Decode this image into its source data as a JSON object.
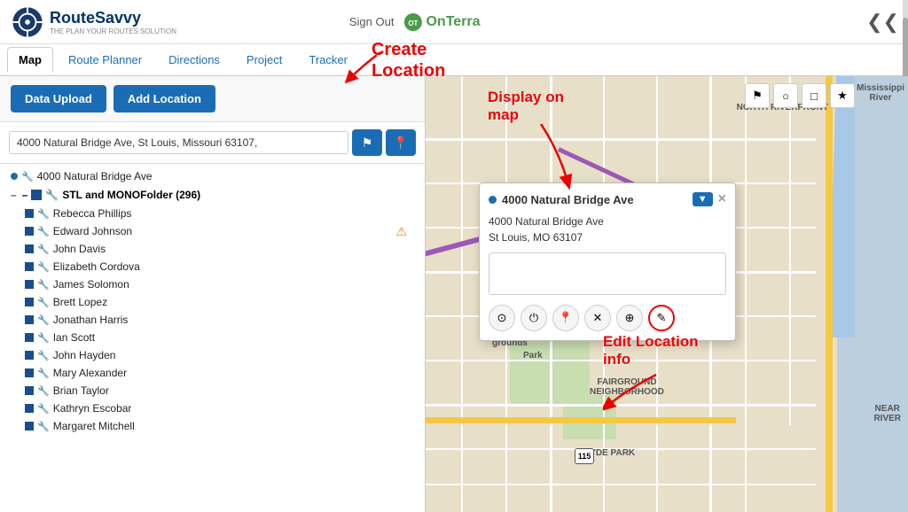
{
  "header": {
    "logo_text": "RouteSavvy",
    "logo_sub": "THE PLAN YOUR ROUTES SOLUTION",
    "sign_out": "Sign Out",
    "onterra": "OnTerra",
    "collapse_icon": "❮❮"
  },
  "nav": {
    "tabs": [
      {
        "label": "Map",
        "active": true
      },
      {
        "label": "Route Planner"
      },
      {
        "label": "Directions"
      },
      {
        "label": "Project"
      },
      {
        "label": "Tracker"
      }
    ]
  },
  "toolbar": {
    "data_upload": "Data Upload",
    "add_location": "Add Location"
  },
  "search": {
    "value": "4000 Natural Bridge Ave, St Louis, Missouri 63107,",
    "flag_icon": "⚑",
    "pin_icon": "📍"
  },
  "annotations": {
    "create_location": "Create\nLocation",
    "display_on_map": "Display on\nmap",
    "edit_location": "Edit Location\ninfo"
  },
  "location_list": {
    "top_item": {
      "label": "4000 Natural Bridge Ave"
    },
    "folder": {
      "label": "STL and MONOFolder (296)"
    },
    "items": [
      {
        "label": "Rebecca Phillips"
      },
      {
        "label": "Edward Johnson",
        "warning": true
      },
      {
        "label": "John Davis"
      },
      {
        "label": "Elizabeth Cordova"
      },
      {
        "label": "James Solomon"
      },
      {
        "label": "Brett Lopez"
      },
      {
        "label": "Jonathan Harris"
      },
      {
        "label": "Ian Scott"
      },
      {
        "label": "John Hayden"
      },
      {
        "label": "Mary Alexander"
      },
      {
        "label": "Brian Taylor"
      },
      {
        "label": "Kathryn Escobar"
      },
      {
        "label": "Margaret Mitchell"
      }
    ]
  },
  "popup": {
    "title": "4000 Natural Bridge Ave",
    "address_line1": "4000 Natural Bridge Ave",
    "address_line2": "St Louis, MO 63107",
    "close": "×",
    "dropdown_arrow": "▼",
    "actions": [
      {
        "icon": "⊙",
        "label": "target"
      },
      {
        "icon": "⏻",
        "label": "power"
      },
      {
        "icon": "📍",
        "label": "pin"
      },
      {
        "icon": "✕",
        "label": "close"
      },
      {
        "icon": "⊕",
        "label": "add"
      },
      {
        "icon": "✎",
        "label": "edit"
      }
    ]
  },
  "map": {
    "labels": [
      {
        "text": "Mississippi\nRiver",
        "top": "10",
        "right": "8"
      },
      {
        "text": "NORTH RIVERFRONT",
        "top": "38",
        "right": "30"
      },
      {
        "text": "FAIRGROUND\nNEIGHBORHOOD",
        "top": "345",
        "left": "200"
      },
      {
        "text": "HYDE PARK",
        "top": "420",
        "left": "180"
      },
      {
        "text": "NEAR\nRIVER",
        "top": "370",
        "right": "5"
      },
      {
        "text": "Park",
        "top": "310",
        "left": "120"
      },
      {
        "text": "Fair-\ngrounds",
        "top": "290",
        "left": "85"
      },
      {
        "text": "115",
        "top": "420",
        "left": "170"
      }
    ],
    "toolbar_buttons": [
      "⚑",
      "○",
      "□",
      "★"
    ]
  }
}
